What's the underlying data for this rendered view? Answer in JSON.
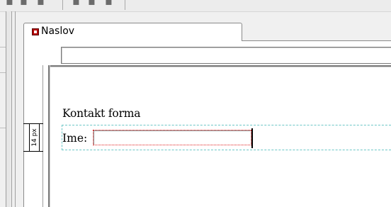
{
  "tab": {
    "label": "Naslov",
    "icon": "page-icon"
  },
  "address_bar": {
    "value": ""
  },
  "page": {
    "heading": "Kontakt forma",
    "ime_label": "Ime:",
    "ime_value": ""
  },
  "spacing_badge": {
    "text": "14 px"
  },
  "colors": {
    "guide_dashed": "#6cc7c7",
    "input_outline": "#e02020",
    "tab_icon": "#b40000"
  }
}
